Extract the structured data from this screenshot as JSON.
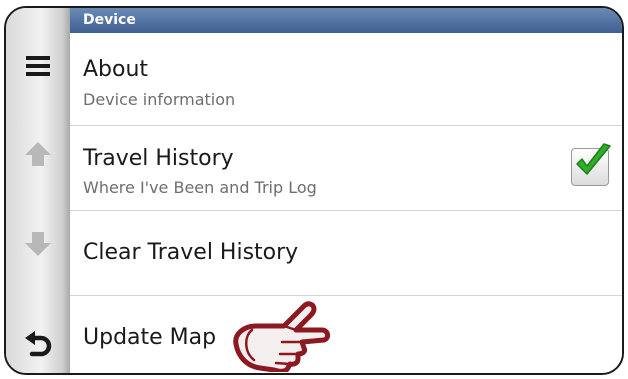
{
  "header": {
    "title": "Device"
  },
  "sidebar": {
    "items": [
      {
        "icon": "menu-icon"
      },
      {
        "icon": "arrow-up-icon"
      },
      {
        "icon": "arrow-down-icon"
      },
      {
        "icon": "back-icon"
      }
    ]
  },
  "menu": {
    "items": [
      {
        "title": "About",
        "subtitle": "Device information"
      },
      {
        "title": "Travel History",
        "subtitle": "Where I've Been and Trip Log",
        "checked": true
      },
      {
        "title": "Clear Travel History"
      },
      {
        "title": "Update Map",
        "icon": "pointing-hand-icon"
      }
    ]
  },
  "colors": {
    "header": "#4a6a9a",
    "check": "#2fae2a",
    "hand": "#9b1b24"
  }
}
